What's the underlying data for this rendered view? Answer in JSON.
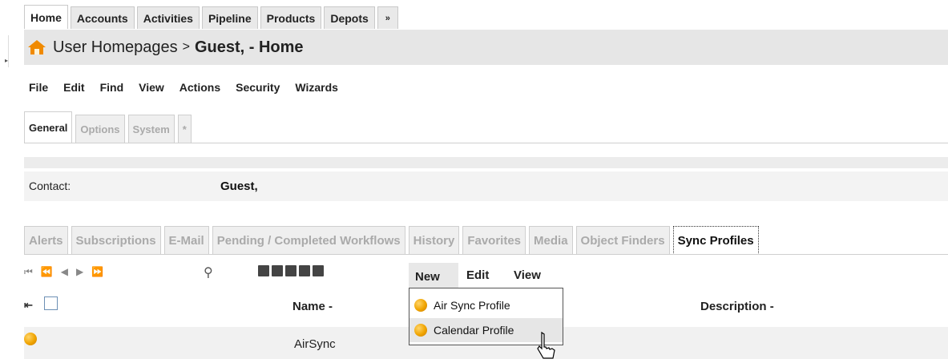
{
  "top_tabs": [
    "Home",
    "Accounts",
    "Activities",
    "Pipeline",
    "Products",
    "Depots",
    "»"
  ],
  "title_bar": {
    "crumb": "User Homepages",
    "separator": ">",
    "current": "Guest, - Home"
  },
  "menu": [
    "File",
    "Edit",
    "Find",
    "View",
    "Actions",
    "Security",
    "Wizards"
  ],
  "sub_tabs": [
    "General",
    "Options",
    "System",
    "*"
  ],
  "contact": {
    "label": "Contact:",
    "value": "Guest,"
  },
  "lower_tabs": [
    "Alerts",
    "Subscriptions",
    "E-Mail",
    "Pending / Completed Workflows",
    "History",
    "Favorites",
    "Media",
    "Object Finders",
    "Sync Profiles"
  ],
  "pager_icons": [
    "first-page-icon",
    "previous-page-icon",
    "previous-icon",
    "next-icon",
    "last-page-icon"
  ],
  "list_menu": {
    "new": "New",
    "edit": "Edit",
    "view": "View"
  },
  "dropdown": [
    "Air Sync Profile",
    "Calendar Profile"
  ],
  "table": {
    "columns": [
      "Name",
      "Description"
    ],
    "sort_marker": "-",
    "rows": [
      {
        "name": "AirSync",
        "description": ""
      }
    ]
  },
  "colors": {
    "accent_orange": "#f0a400",
    "title_bar_bg": "#e6e6e6",
    "row_bg": "#f1f1f1"
  }
}
